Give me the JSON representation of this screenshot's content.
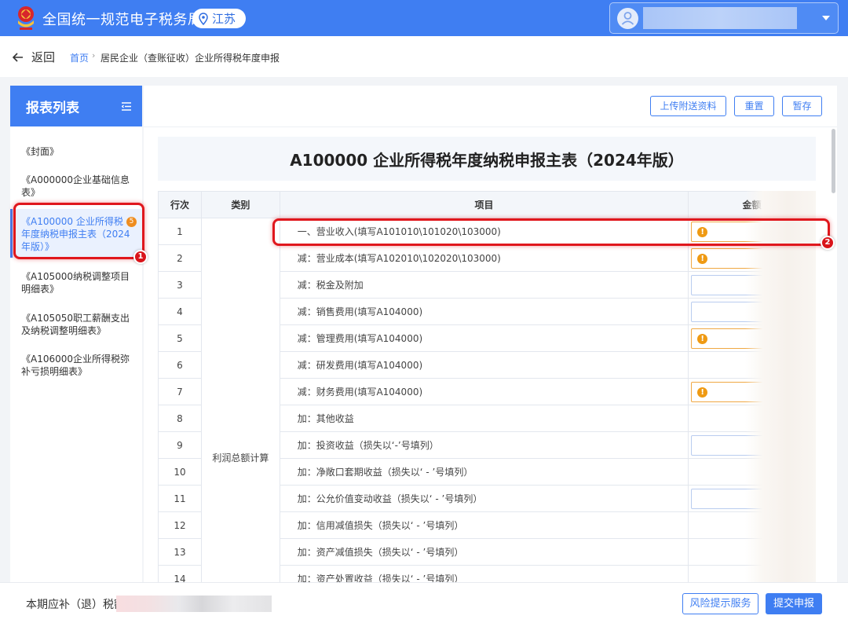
{
  "header": {
    "site_title": "全国统一规范电子税务局",
    "region": "江苏",
    "colors": {
      "primary": "#3f7ef2",
      "warning": "#ef9a13",
      "annotation": "#e0171d"
    }
  },
  "breadcrumb": {
    "back_label": "返回",
    "home": "首页",
    "separator": "›",
    "current": "居民企业（查账征收）企业所得税年度申报"
  },
  "sidebar": {
    "title": "报表列表",
    "items": [
      {
        "label": "《封面》"
      },
      {
        "label": "《A000000企业基础信息表》"
      },
      {
        "label": "《A100000 企业所得税年度纳税申报主表（2024年版）》",
        "badge": "5",
        "active": true
      },
      {
        "label": "《A105000纳税调整项目明细表》"
      },
      {
        "label": "《A105050职工薪酬支出及纳税调整明细表》"
      },
      {
        "label": "《A106000企业所得税弥补亏损明细表》"
      }
    ]
  },
  "toolbar": {
    "upload_label": "上传附送资料",
    "reset_label": "重置",
    "save_label": "暂存"
  },
  "form": {
    "title": "A100000 企业所得税年度纳税申报主表（2024年版）",
    "headers": {
      "row": "行次",
      "category": "类别",
      "item": "项目",
      "amount": "金额"
    },
    "category_label": "利润总额计算",
    "rows": [
      {
        "num": "1",
        "item": "一、营业收入(填写A101010\\101020\\103000)",
        "input": "warn"
      },
      {
        "num": "2",
        "item": "减：营业成本(填写A102010\\102020\\103000)",
        "input": "warn"
      },
      {
        "num": "3",
        "item": "减：税金及附加",
        "input": "normal"
      },
      {
        "num": "4",
        "item": "减：销售费用(填写A104000)",
        "input": "normal"
      },
      {
        "num": "5",
        "item": "减：管理费用(填写A104000)",
        "input": "warn"
      },
      {
        "num": "6",
        "item": "减：研发费用(填写A104000)",
        "input": "none"
      },
      {
        "num": "7",
        "item": "减：财务费用(填写A104000)",
        "input": "warn"
      },
      {
        "num": "8",
        "item": "加：其他收益",
        "input": "none"
      },
      {
        "num": "9",
        "item": "加：投资收益（损失以‘-’号填列）",
        "input": "normal"
      },
      {
        "num": "10",
        "item": "加：净敞口套期收益（损失以‘ - ’号填列）",
        "input": "none"
      },
      {
        "num": "11",
        "item": "加：公允价值变动收益（损失以‘ - ’号填列）",
        "input": "normal"
      },
      {
        "num": "12",
        "item": "加：信用减值损失（损失以‘ - ’号填列）",
        "input": "none"
      },
      {
        "num": "13",
        "item": "加：资产减值损失（损失以‘ - ’号填列）",
        "input": "none"
      },
      {
        "num": "14",
        "item": "加：资产处置收益（损失以‘ - ’号填列）",
        "input": "none"
      }
    ]
  },
  "annotations": {
    "first": "1",
    "second": "2"
  },
  "footer": {
    "tax_label": "本期应补（退）税额",
    "risk_button": "风险提示服务",
    "submit_button": "提交申报"
  }
}
